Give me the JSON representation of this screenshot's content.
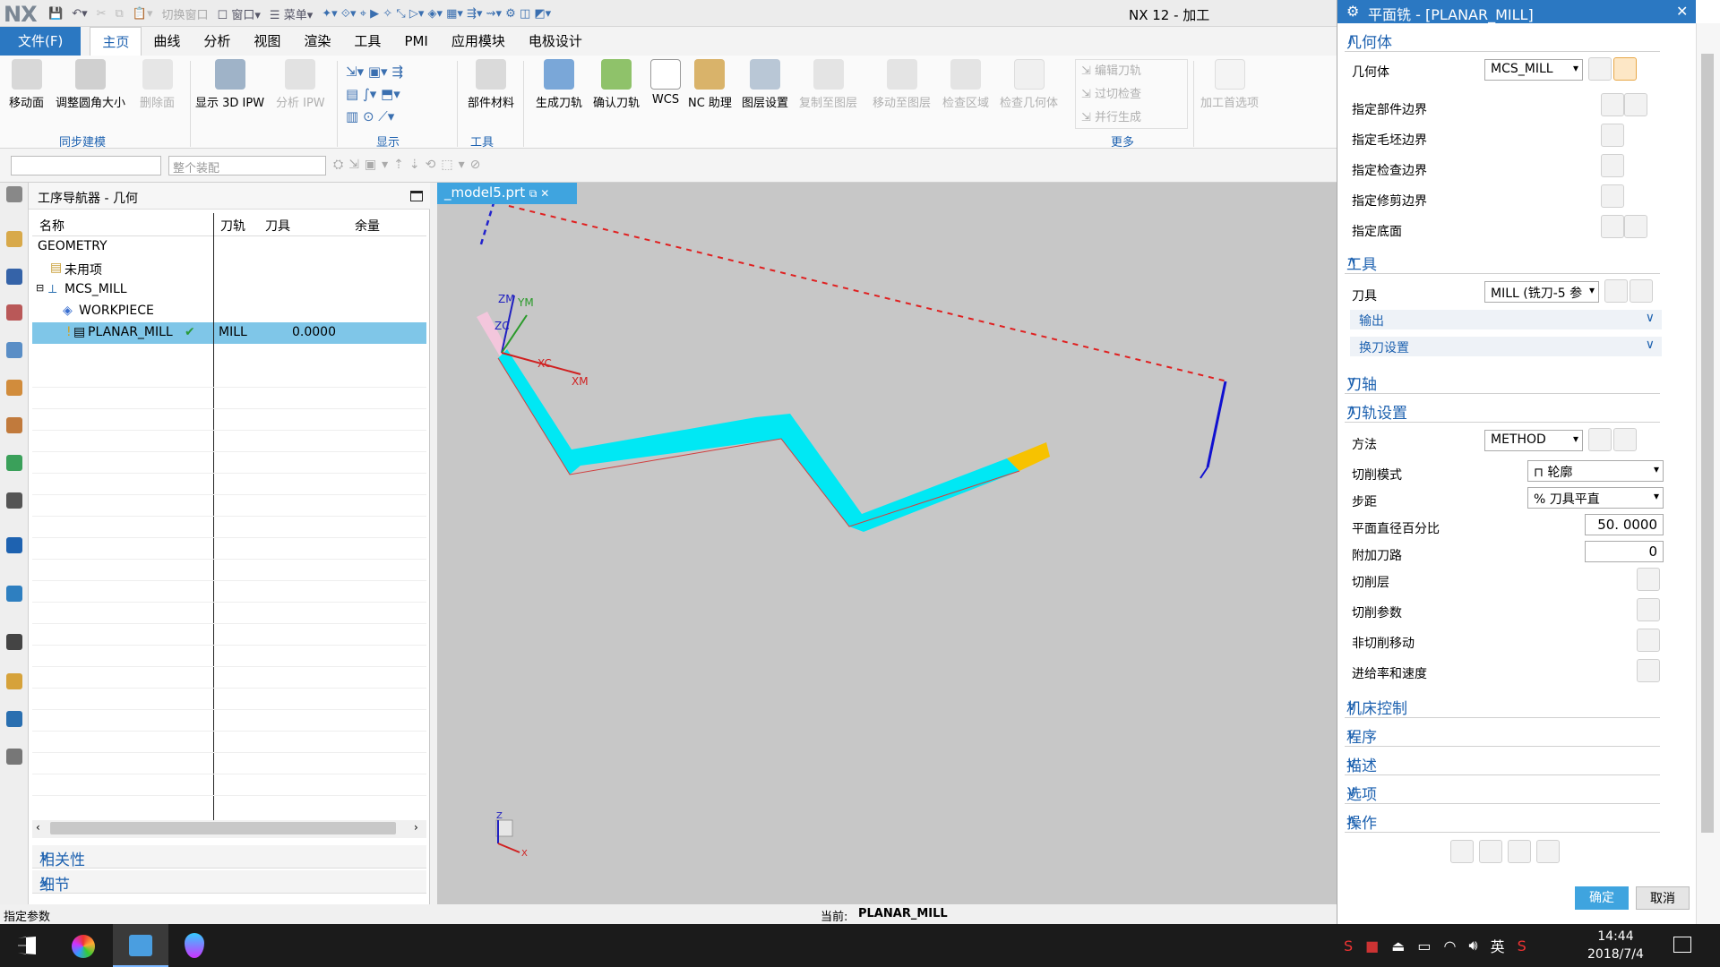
{
  "app": {
    "logo": "NX",
    "title": "NX 12 - 加工"
  },
  "qat": {
    "switch_window": "切换窗口",
    "window": "窗口",
    "menu": "菜单"
  },
  "menubar": {
    "file": "文件(F)",
    "tabs": [
      "主页",
      "曲线",
      "分析",
      "视图",
      "渲染",
      "工具",
      "PMI",
      "应用模块",
      "电极设计"
    ]
  },
  "ribbon": {
    "move_face": "移动面",
    "resize_blend": "调整圆角大小",
    "delete_face": "删除面",
    "show_3d_ipw": "显示 3D IPW",
    "analyze_ipw": "分析 IPW",
    "part_material": "部件材料",
    "generate_toolpath": "生成刀轨",
    "verify_toolpath": "确认刀轨",
    "wcs": "WCS",
    "nc_assistant": "NC 助理",
    "layer_settings": "图层设置",
    "copy_to_layer": "复制至图层",
    "move_to_layer": "移动至图层",
    "check_region": "检查区域",
    "check_geometry": "检查几何体",
    "edit_toolpath": "编辑刀轨",
    "gouge_check": "过切检查",
    "parallel_generate": "并行生成",
    "machining_prefs": "加工首选项",
    "groups": {
      "sync_modeling": "同步建模",
      "display": "显示",
      "tools": "工具",
      "more": "更多"
    }
  },
  "selbar": {
    "filter": "",
    "scope": "整个装配"
  },
  "navigator": {
    "title": "工序导航器 - 几何",
    "columns": [
      "名称",
      "刀轨",
      "刀具",
      "余量"
    ],
    "rows": [
      {
        "name": "GEOMETRY",
        "path": "",
        "tool": "",
        "stock": ""
      },
      {
        "name": "未用项",
        "path": "",
        "tool": "",
        "stock": ""
      },
      {
        "name": "MCS_MILL",
        "path": "",
        "tool": "",
        "stock": ""
      },
      {
        "name": "WORKPIECE",
        "path": "",
        "tool": "",
        "stock": ""
      },
      {
        "name": "PLANAR_MILL",
        "path": "✔",
        "tool": "MILL",
        "stock": "0.0000"
      }
    ],
    "dependencies": "相关性",
    "details": "细节"
  },
  "viewport": {
    "tab": "_model5.prt",
    "labels": {
      "zm": "ZM",
      "ym": "YM",
      "zc": "ZC",
      "xc": "XC",
      "xm": "XM",
      "z": "Z",
      "x": "X"
    }
  },
  "status": {
    "left": "指定参数",
    "current_label": "当前:",
    "current_value": "PLANAR_MILL"
  },
  "panel": {
    "title": "平面铣 - [PLANAR_MILL]",
    "geometry": {
      "section": "几何体",
      "geometry_label": "几何体",
      "geometry_value": "MCS_MILL",
      "rows": [
        "指定部件边界",
        "指定毛坯边界",
        "指定检查边界",
        "指定修剪边界",
        "指定底面"
      ]
    },
    "tool": {
      "section": "工具",
      "tool_label": "刀具",
      "tool_value": "MILL (铣刀-5 参",
      "output": "输出",
      "tool_change": "换刀设置"
    },
    "tool_axis": "刀轴",
    "path_settings": {
      "section": "刀轨设置",
      "method_label": "方法",
      "method_value": "METHOD",
      "cut_pattern_label": "切削模式",
      "cut_pattern_value": "轮廓",
      "stepover_label": "步距",
      "stepover_value": "% 刀具平直",
      "percent_label": "平面直径百分比",
      "percent_value": "50. 0000",
      "additional_label": "附加刀路",
      "additional_value": "0",
      "cut_levels": "切削层",
      "cut_params": "切削参数",
      "noncut_moves": "非切削移动",
      "feeds_speeds": "进给率和速度"
    },
    "machine_control": "机床控制",
    "program": "程序",
    "description": "描述",
    "options": "选项",
    "actions": "操作",
    "ok": "确定",
    "cancel": "取消"
  },
  "tray": {
    "ime": "英",
    "time": "14:44",
    "date": "2018/7/4"
  }
}
